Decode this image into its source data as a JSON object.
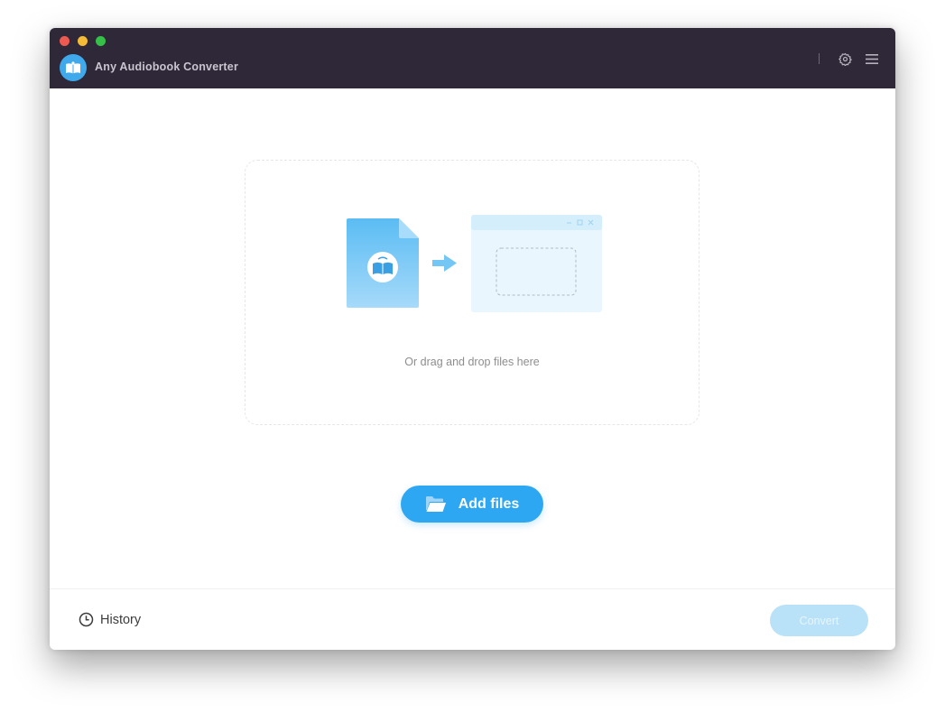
{
  "window": {
    "title": "Any Audiobook Converter",
    "controls": [
      "close",
      "minimize",
      "maximize"
    ]
  },
  "toolbar": {
    "icons": [
      "settings-gear-icon",
      "menu-hamburger-icon"
    ]
  },
  "dropzone": {
    "hint": "Or drag and drop files here",
    "illustration": [
      "audiobook-file-icon",
      "arrow-right-icon",
      "app-window-icon"
    ]
  },
  "actions": {
    "add_files_label": "Add files",
    "convert_label": "Convert",
    "convert_enabled": false
  },
  "footer": {
    "history_label": "History"
  },
  "colors": {
    "titlebar": "#2f2838",
    "accent": "#2ea7f2",
    "accent_disabled": "#b9e2f8"
  }
}
